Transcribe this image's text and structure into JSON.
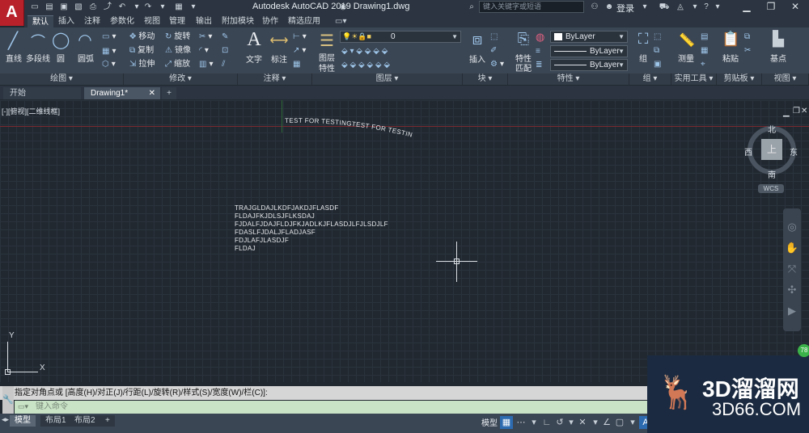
{
  "app": {
    "logo_letter": "A",
    "title": "Autodesk AutoCAD 2019    Drawing1.dwg"
  },
  "search": {
    "placeholder": "键入关键字或短语"
  },
  "user": {
    "login": "登录"
  },
  "ribbon_tabs": [
    "默认",
    "插入",
    "注释",
    "参数化",
    "视图",
    "管理",
    "输出",
    "附加模块",
    "协作",
    "精选应用"
  ],
  "draw_panel": {
    "line": "直线",
    "polyline": "多段线",
    "circle": "圆",
    "arc": "圆弧",
    "label": "绘图"
  },
  "modify_panel": {
    "move": "移动",
    "rotate": "旋转",
    "copy": "复制",
    "mirror": "镜像",
    "stretch": "拉伸",
    "scale": "缩放",
    "label": "修改"
  },
  "annotation_panel": {
    "text": "文字",
    "dimension": "标注",
    "label": "注释"
  },
  "layers_panel": {
    "properties_top": "图层",
    "properties_bottom": "特性",
    "current_layer": "0",
    "label": "图层"
  },
  "block_panel": {
    "insert": "插入",
    "label": "块"
  },
  "properties_panel": {
    "match_top": "特性",
    "match_bottom": "匹配",
    "color": "ByLayer",
    "linetype": "ByLayer",
    "lineweight": "ByLayer",
    "label": "特性"
  },
  "groups_panel": {
    "group": "组",
    "label": "组"
  },
  "utilities_panel": {
    "measure": "测量",
    "label": "实用工具"
  },
  "clipboard_panel": {
    "paste": "粘贴",
    "label": "剪贴板"
  },
  "view_panel": {
    "base": "基点",
    "label": "视图"
  },
  "file_tabs": [
    "开始",
    "Drawing1*"
  ],
  "viewport": {
    "label": "[-][俯视][二维线框]"
  },
  "drawing": {
    "arc_text": "TEST FOR TESTINGTEST FOR TESTING",
    "mtext_lines": [
      "TRAJGLDAJLKDFJAKDJFLASDF",
      "FLDAJFKJDLSJFLKSDAJ",
      "FJDALFJDAJFLDJFKJADLKJFLASDJLFJLSDJLF",
      "FDASLFJDALJFLADJASF",
      "FDJLAFJLASDJF",
      "FLDAJ"
    ]
  },
  "viewcube": {
    "north": "北",
    "south": "南",
    "west": "西",
    "east": "东",
    "face": "上",
    "wcs": "WCS"
  },
  "ucs": {
    "y": "Y",
    "x": "X"
  },
  "command": {
    "history": "指定对角点或 [高度(H)/对正(J)/行距(L)/旋转(R)/样式(S)/宽度(W)/栏(C)]:",
    "placeholder": "键入命令"
  },
  "layout_tabs": [
    "模型",
    "布局1",
    "布局2"
  ],
  "status": {
    "model": "模型"
  },
  "watermark": {
    "text": "3D溜溜网",
    "sub": "3D66.COM",
    "badge": "78"
  }
}
